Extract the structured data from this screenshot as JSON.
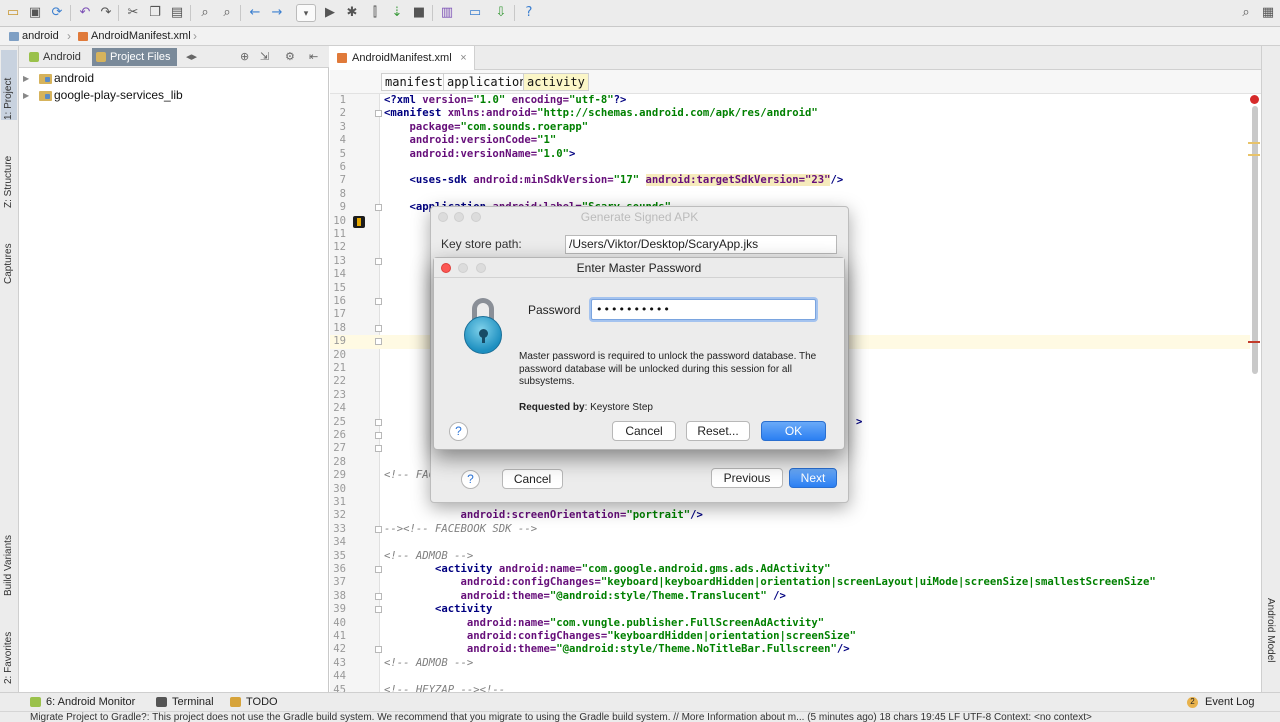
{
  "breadcrumb": {
    "project": "android",
    "file": "AndroidManifest.xml"
  },
  "left_tool_tabs": [
    "1: Project",
    "Z: Structure",
    "Captures",
    "Build Variants",
    "2: Favorites"
  ],
  "right_tool_tabs": [
    "Android Model"
  ],
  "project_panel": {
    "tabs": [
      "Android",
      "Project Files"
    ],
    "selected_tab": "Project Files",
    "tree": [
      {
        "label": "android"
      },
      {
        "label": "google-play-services_lib"
      }
    ]
  },
  "editor": {
    "tab_label": "AndroidManifest.xml",
    "xml_breadcrumbs": [
      "manifest",
      "application",
      "activity"
    ],
    "lines": [
      {
        "n": "1",
        "segs": [
          {
            "c": "tg",
            "t": "<?xml "
          },
          {
            "c": "at",
            "t": "version="
          },
          {
            "c": "st",
            "t": "\"1.0\" "
          },
          {
            "c": "at",
            "t": "encoding="
          },
          {
            "c": "st",
            "t": "\"utf-8\""
          },
          {
            "c": "tg",
            "t": "?>"
          }
        ]
      },
      {
        "n": "2",
        "segs": [
          {
            "c": "tg",
            "t": "<manifest "
          },
          {
            "c": "at",
            "t": "xmlns:android="
          },
          {
            "c": "st",
            "t": "\"http://schemas.android.com/apk/res/android\""
          }
        ]
      },
      {
        "n": "3",
        "segs": [
          {
            "c": "",
            "t": "    "
          },
          {
            "c": "at",
            "t": "package="
          },
          {
            "c": "st",
            "t": "\"com.sounds.roerapp\""
          }
        ]
      },
      {
        "n": "4",
        "segs": [
          {
            "c": "",
            "t": "    "
          },
          {
            "c": "at",
            "t": "android:versionCode="
          },
          {
            "c": "st",
            "t": "\"1\""
          }
        ]
      },
      {
        "n": "5",
        "segs": [
          {
            "c": "",
            "t": "    "
          },
          {
            "c": "at",
            "t": "android:versionName="
          },
          {
            "c": "st",
            "t": "\"1.0\""
          },
          {
            "c": "tg",
            "t": ">"
          }
        ]
      },
      {
        "n": "6",
        "segs": []
      },
      {
        "n": "7",
        "segs": [
          {
            "c": "",
            "t": "    "
          },
          {
            "c": "tg",
            "t": "<uses-sdk "
          },
          {
            "c": "at",
            "t": "android:minSdkVersion="
          },
          {
            "c": "st",
            "t": "\"17\" "
          },
          {
            "c": "at hl",
            "t": "android:targetSdkVersion=\"23\""
          },
          {
            "c": "tg",
            "t": "/>"
          }
        ]
      },
      {
        "n": "8",
        "segs": []
      },
      {
        "n": "9",
        "segs": [
          {
            "c": "",
            "t": "    "
          },
          {
            "c": "tg",
            "t": "<application "
          },
          {
            "c": "at",
            "t": "android:label="
          },
          {
            "c": "st",
            "t": "\"Scary sounds\""
          }
        ]
      },
      {
        "n": "10",
        "segs": []
      },
      {
        "n": "11",
        "segs": []
      },
      {
        "n": "12",
        "segs": []
      },
      {
        "n": "13",
        "segs": []
      },
      {
        "n": "14",
        "segs": []
      },
      {
        "n": "15",
        "segs": []
      },
      {
        "n": "16",
        "segs": []
      },
      {
        "n": "17",
        "segs": []
      },
      {
        "n": "18",
        "segs": []
      },
      {
        "n": "19",
        "segs": []
      },
      {
        "n": "20",
        "segs": []
      },
      {
        "n": "21",
        "segs": []
      },
      {
        "n": "22",
        "segs": []
      },
      {
        "n": "23",
        "segs": []
      },
      {
        "n": "24",
        "segs": []
      },
      {
        "n": "25",
        "segs": [
          {
            "c": "",
            "t": "                                                                          "
          },
          {
            "c": "tg",
            "t": ">"
          }
        ]
      },
      {
        "n": "26",
        "segs": []
      },
      {
        "n": "27",
        "segs": []
      },
      {
        "n": "28",
        "segs": []
      },
      {
        "n": "29",
        "segs": [
          {
            "c": "cm",
            "t": "<!-- FACEBOOK SDK -->"
          }
        ]
      },
      {
        "n": "30",
        "segs": []
      },
      {
        "n": "31",
        "segs": []
      },
      {
        "n": "32",
        "segs": [
          {
            "c": "",
            "t": "            "
          },
          {
            "c": "at",
            "t": "android:screenOrientation="
          },
          {
            "c": "st",
            "t": "\"portrait\""
          },
          {
            "c": "tg",
            "t": "/>"
          }
        ]
      },
      {
        "n": "33",
        "segs": [
          {
            "c": "cm",
            "t": "--><!-- FACEBOOK SDK -->"
          }
        ]
      },
      {
        "n": "34",
        "segs": []
      },
      {
        "n": "35",
        "segs": [
          {
            "c": "cm",
            "t": "<!-- ADMOB -->"
          }
        ]
      },
      {
        "n": "36",
        "segs": [
          {
            "c": "",
            "t": "        "
          },
          {
            "c": "tg",
            "t": "<activity "
          },
          {
            "c": "at",
            "t": "android:name="
          },
          {
            "c": "st",
            "t": "\"com.google.android.gms.ads.AdActivity\""
          }
        ]
      },
      {
        "n": "37",
        "segs": [
          {
            "c": "",
            "t": "            "
          },
          {
            "c": "at",
            "t": "android:configChanges="
          },
          {
            "c": "st",
            "t": "\"keyboard|keyboardHidden|orientation|screenLayout|uiMode|screenSize|smallestScreenSize\""
          }
        ]
      },
      {
        "n": "38",
        "segs": [
          {
            "c": "",
            "t": "            "
          },
          {
            "c": "at",
            "t": "android:theme="
          },
          {
            "c": "st",
            "t": "\"@android:style/Theme.Translucent\""
          },
          {
            "c": "tg",
            "t": " />"
          }
        ]
      },
      {
        "n": "39",
        "segs": [
          {
            "c": "",
            "t": "        "
          },
          {
            "c": "tg",
            "t": "<activity"
          }
        ]
      },
      {
        "n": "40",
        "segs": [
          {
            "c": "",
            "t": "             "
          },
          {
            "c": "at",
            "t": "android:name="
          },
          {
            "c": "st",
            "t": "\"com.vungle.publisher.FullScreenAdActivity\""
          }
        ]
      },
      {
        "n": "41",
        "segs": [
          {
            "c": "",
            "t": "             "
          },
          {
            "c": "at",
            "t": "android:configChanges="
          },
          {
            "c": "st",
            "t": "\"keyboardHidden|orientation|screenSize\""
          }
        ]
      },
      {
        "n": "42",
        "segs": [
          {
            "c": "",
            "t": "             "
          },
          {
            "c": "at",
            "t": "android:theme="
          },
          {
            "c": "st",
            "t": "\"@android:style/Theme.NoTitleBar.Fullscreen\""
          },
          {
            "c": "tg",
            "t": "/>"
          }
        ]
      },
      {
        "n": "43",
        "segs": [
          {
            "c": "cm",
            "t": "<!-- ADMOB -->"
          }
        ]
      },
      {
        "n": "44",
        "segs": []
      },
      {
        "n": "45",
        "segs": [
          {
            "c": "cm",
            "t": "<!-- HEYZAP --><!--"
          }
        ]
      }
    ]
  },
  "signed_apk_dialog": {
    "title": "Generate Signed APK",
    "keystore_label": "Key store path:",
    "keystore_value": "/Users/Viktor/Desktop/ScaryApp.jks",
    "help": "?",
    "cancel": "Cancel",
    "previous": "Previous",
    "next": "Next"
  },
  "master_password_dialog": {
    "title": "Enter Master Password",
    "password_label": "Password",
    "password_value": "••••••••••",
    "message": "Master password is required to unlock the password database. The password database will be unlocked during this session for all subsystems.",
    "requested_by_label": "Requested by",
    "requested_by_value": ": Keystore Step",
    "help": "?",
    "cancel": "Cancel",
    "reset": "Reset...",
    "ok": "OK"
  },
  "status_tabs": {
    "android_monitor": "6: Android Monitor",
    "terminal": "Terminal",
    "todo": "TODO",
    "event_log_count": "2",
    "event_log": "Event Log"
  },
  "message_bar": "Migrate Project to Gradle?: This project does not use the Gradle build system. We recommend that you migrate to using the Gradle build system. // More Information about m... (5 minutes ago)   18 chars   19:45   LF   UTF-8   Context: <no context>",
  "colors": {
    "accent": "#2b7ff2",
    "close_red": "#fc5753",
    "error": "#d62a2a"
  }
}
